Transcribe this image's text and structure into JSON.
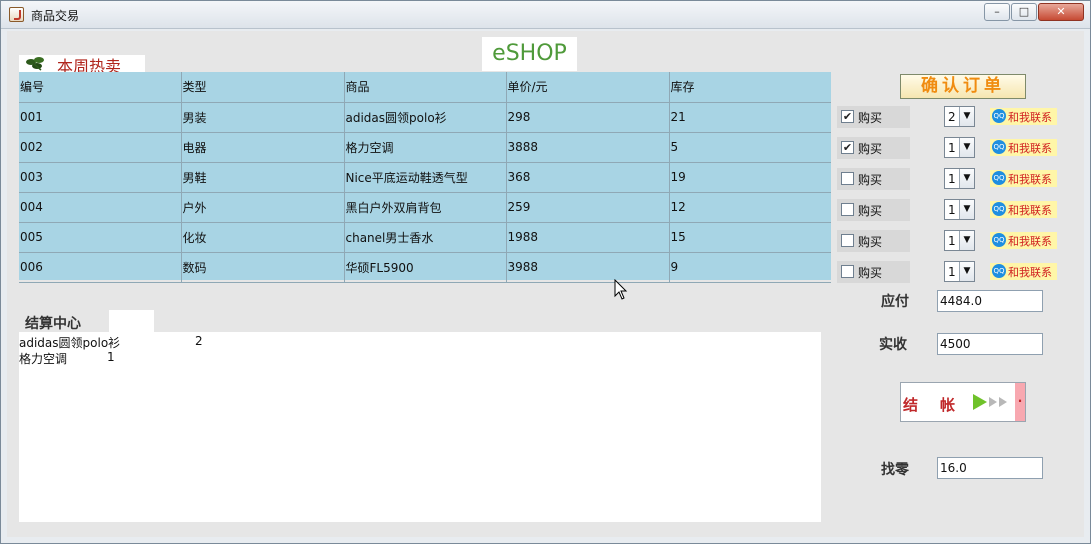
{
  "window": {
    "title": "商品交易"
  },
  "header": {
    "hot_label": "本周热卖",
    "logo": "eSHOP"
  },
  "table": {
    "columns": [
      "编号",
      "类型",
      "商品",
      "单价/元",
      "库存"
    ],
    "rows": [
      [
        "001",
        "男装",
        "adidas圆领polo衫",
        "298",
        "21"
      ],
      [
        "002",
        "电器",
        "格力空调",
        "3888",
        "5"
      ],
      [
        "003",
        "男鞋",
        "Nice平底运动鞋透气型",
        "368",
        "19"
      ],
      [
        "004",
        "户外",
        "黑白户外双肩背包",
        "259",
        "12"
      ],
      [
        "005",
        "化妆",
        "chanel男士香水",
        "1988",
        "15"
      ],
      [
        "006",
        "数码",
        "华硕FL5900",
        "3988",
        "9"
      ]
    ]
  },
  "orders": {
    "confirm_label": "确认订单",
    "buy_label": "购买",
    "contact_label": "和我联系",
    "items": [
      {
        "checked": "✔",
        "qty": "2"
      },
      {
        "checked": "✔",
        "qty": "1"
      },
      {
        "checked": "",
        "qty": "1"
      },
      {
        "checked": "",
        "qty": "1"
      },
      {
        "checked": "",
        "qty": "1"
      },
      {
        "checked": "",
        "qty": "1"
      }
    ]
  },
  "settlement": {
    "title": "结算中心",
    "lines": [
      {
        "name": "adidas圆领polo衫",
        "qty": "2"
      },
      {
        "name": "格力空调",
        "qty": "1"
      }
    ]
  },
  "payment": {
    "due_label": "应付",
    "due_value": "4484.0",
    "received_label": "实收",
    "received_value": "4500",
    "checkout_label": "结帐",
    "change_label": "找零",
    "change_value": "16.0"
  },
  "colors": {
    "table_bg": "#a8d4e4",
    "logo_green": "#4f9a3a",
    "confirm_orange": "#f08c10",
    "checkout_red": "#c0282a"
  }
}
